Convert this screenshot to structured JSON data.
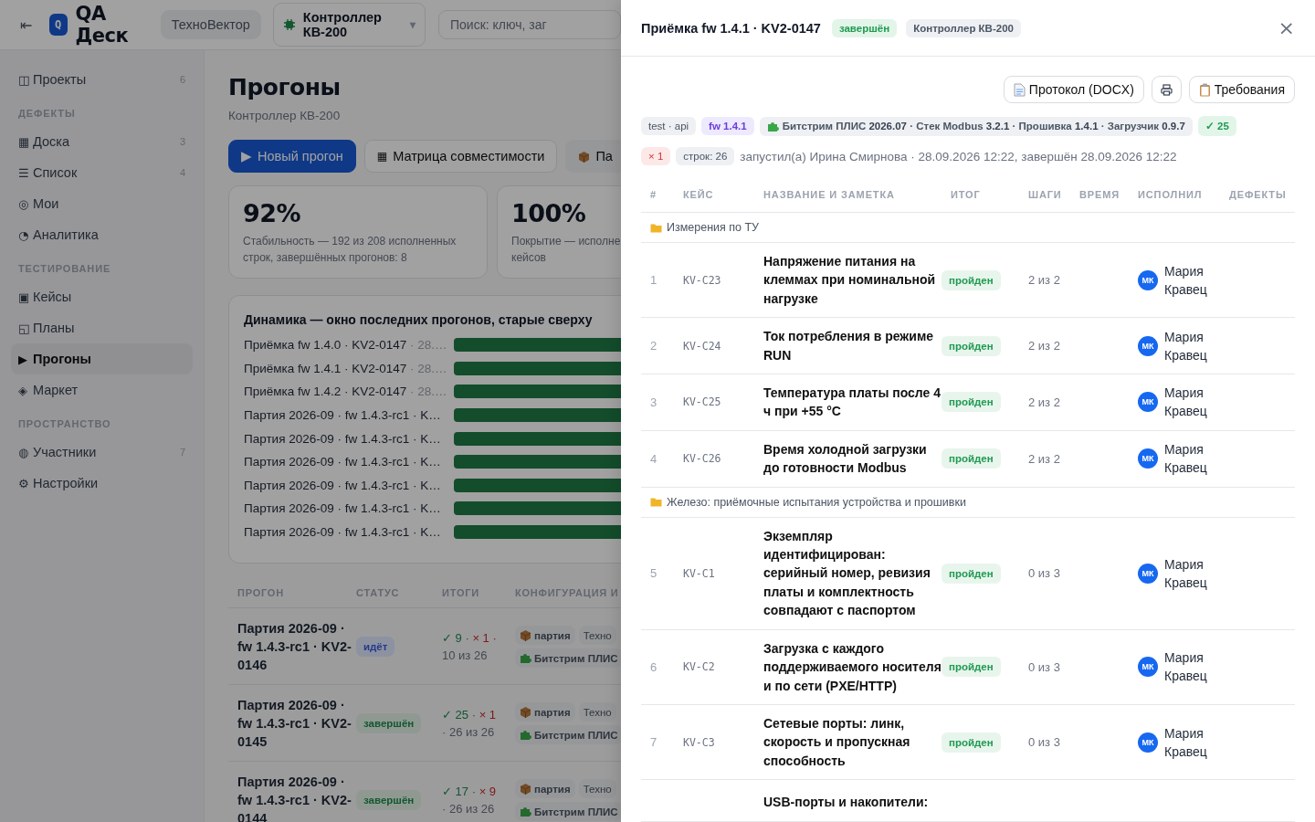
{
  "topbar": {
    "back_icon": "⇤",
    "logo_letter": "Q",
    "app_name": "QA Деск",
    "workspace": "ТехноВектор",
    "project": "Контроллер КВ-200",
    "project_caret": "▾",
    "search": {
      "placeholder": "Поиск: ключ, заг"
    }
  },
  "sidebar": {
    "items": [
      {
        "kind": "item",
        "icon": "◫",
        "label": "Проекты",
        "count": "6",
        "selected": false
      },
      {
        "kind": "section",
        "label": "ДЕФЕКТЫ"
      },
      {
        "kind": "item",
        "icon": "▦",
        "label": "Доска",
        "count": "3",
        "selected": false
      },
      {
        "kind": "item",
        "icon": "☰",
        "label": "Список",
        "count": "4",
        "selected": false
      },
      {
        "kind": "item",
        "icon": "◎",
        "label": "Мои",
        "selected": false
      },
      {
        "kind": "item",
        "icon": "◔",
        "label": "Аналитика",
        "selected": false
      },
      {
        "kind": "section",
        "label": "ТЕСТИРОВАНИЕ"
      },
      {
        "kind": "item",
        "icon": "▣",
        "label": "Кейсы",
        "selected": false
      },
      {
        "kind": "item",
        "icon": "◱",
        "label": "Планы",
        "selected": false
      },
      {
        "kind": "item",
        "icon": "▶",
        "label": "Прогоны",
        "selected": true
      },
      {
        "kind": "item",
        "icon": "◈",
        "label": "Маркет",
        "selected": false
      },
      {
        "kind": "section",
        "label": "ПРОСТРАНСТВО"
      },
      {
        "kind": "item",
        "icon": "◍",
        "label": "Участники",
        "count": "7",
        "selected": false
      },
      {
        "kind": "item",
        "icon": "⚙",
        "label": "Настройки",
        "selected": false
      }
    ]
  },
  "page": {
    "title": "Прогоны",
    "subtitle": "Контроллер КВ-200",
    "actions": [
      {
        "kind": "primary",
        "icon": "▶",
        "label": "Новый прогон"
      },
      {
        "kind": "secondary",
        "icon": "▦",
        "label": "Матрица совместимости"
      },
      {
        "kind": "package",
        "label": "Па"
      }
    ],
    "stats": [
      {
        "value": "92%",
        "caption_lines": [
          "Стабильность — 192 из 208 исполненных",
          "строк, завершённых прогонов: 8"
        ]
      },
      {
        "value": "100%",
        "caption_lines": [
          "Покрытие — исполне",
          "кейсов"
        ]
      }
    ],
    "trend": {
      "title": "Динамика — окно последних прогонов, старые сверху",
      "rows": [
        {
          "label": "Приёмка fw 1.4.0 · KV2-0147",
          "meta": "· 28.…"
        },
        {
          "label": "Приёмка fw 1.4.1 · KV2-0147",
          "meta": "· 28.…"
        },
        {
          "label": "Приёмка fw 1.4.2 · KV2-0147",
          "meta": "· 28.…"
        },
        {
          "label": "Партия 2026-09 · fw 1.4.3-rc1 · K…"
        },
        {
          "label": "Партия 2026-09 · fw 1.4.3-rc1 · K…"
        },
        {
          "label": "Партия 2026-09 · fw 1.4.3-rc1 · K…"
        },
        {
          "label": "Партия 2026-09 · fw 1.4.3-rc1 · K…"
        },
        {
          "label": "Партия 2026-09 · fw 1.4.3-rc1 · K…"
        },
        {
          "label": "Партия 2026-09 · fw 1.4.3-rc1 · K…"
        }
      ]
    },
    "runs": {
      "columns": [
        "ПРОГОН",
        "СТАТУС",
        "ИТОГИ",
        "КОНФИГУРАЦИЯ И"
      ],
      "rows": [
        {
          "name": "Партия 2026-09 · fw 1.4.3-rc1 · KV2-0146",
          "status": {
            "kind": "running",
            "text": "идёт"
          },
          "passed": "✓ 9 ·",
          "failed": "× 1 ·",
          "total": "10 из 26",
          "tags": [
            {
              "kind": "box",
              "text": "партия"
            },
            {
              "kind": "plain",
              "text": "Техно"
            },
            {
              "kind": "puzzle",
              "text": "Битстрим ПЛИС"
            }
          ]
        },
        {
          "name": "Партия 2026-09 · fw 1.4.3-rc1 · KV2-0145",
          "status": {
            "kind": "done",
            "text": "завершён"
          },
          "passed": "✓ 25 ·",
          "failed": "× 1",
          "total": "· 26 из 26",
          "tags": [
            {
              "kind": "box",
              "text": "партия"
            },
            {
              "kind": "plain",
              "text": "Техно"
            },
            {
              "kind": "puzzle",
              "text": "Битстрим ПЛИС"
            }
          ]
        },
        {
          "name": "Партия 2026-09 · fw 1.4.3-rc1 · KV2-0144",
          "status": {
            "kind": "done",
            "text": "завершён"
          },
          "passed": "✓ 17 ·",
          "failed": "× 9",
          "total": "· 26 из 26",
          "tags": [
            {
              "kind": "box",
              "text": "партия"
            },
            {
              "kind": "plain",
              "text": "Техно"
            },
            {
              "kind": "puzzle",
              "text": "Битстрим ПЛИС"
            }
          ]
        }
      ]
    }
  },
  "drawer": {
    "title": "Приёмка fw 1.4.1 · KV2-0147",
    "status": {
      "kind": "done",
      "text": "завершён"
    },
    "project": "Контроллер КВ-200",
    "close": "×",
    "actions": [
      {
        "kind": "docx",
        "label": "Протокол (DOCX)"
      },
      {
        "kind": "print"
      },
      {
        "kind": "requirements",
        "label": "Требования"
      }
    ],
    "tags": [
      {
        "kind": "plain",
        "text": "test · api"
      },
      {
        "kind": "version",
        "text": "fw 1.4.1"
      },
      {
        "kind": "config",
        "text": "Битстрим ПЛИС **2026.07** · Стек Modbus **3.2.1** · Прошивка **1.4.1** · Загрузчик **0.9.7**"
      },
      {
        "kind": "passed",
        "text": "✓ 25"
      },
      {
        "kind": "failed",
        "text": "× 1"
      },
      {
        "kind": "plain",
        "text": "строк: 26"
      }
    ],
    "started": "запустил(а) Ирина Смирнова · 28.09.2026 12:22, завершён 28.09.2026 12:22",
    "table": {
      "columns": [
        "#",
        "КЕЙС",
        "НАЗВАНИЕ И ЗАМЕТКА",
        "ИТОГ",
        "ШАГИ",
        "ВРЕМЯ",
        "ИСПОЛНИЛ",
        "ДЕФЕКТЫ"
      ],
      "rows": [
        {
          "kind": "group",
          "title": "Измерения по ТУ"
        },
        {
          "kind": "case",
          "num": "1",
          "key": "KV-C23",
          "name": "Напряжение питания на клеммах при номинальной нагрузке",
          "result": {
            "kind": "passed",
            "text": "пройден"
          },
          "steps": "2 из 2",
          "executor": {
            "initials": "МК",
            "name": "Мария Кравец"
          }
        },
        {
          "kind": "case",
          "num": "2",
          "key": "KV-C24",
          "name": "Ток потребления в режиме RUN",
          "result": {
            "kind": "passed",
            "text": "пройден"
          },
          "steps": "2 из 2",
          "executor": {
            "initials": "МК",
            "name": "Мария Кравец"
          }
        },
        {
          "kind": "case",
          "num": "3",
          "key": "KV-C25",
          "name": "Температура платы после 4 ч при +55 °C",
          "result": {
            "kind": "passed",
            "text": "пройден"
          },
          "steps": "2 из 2",
          "executor": {
            "initials": "МК",
            "name": "Мария Кравец"
          }
        },
        {
          "kind": "case",
          "num": "4",
          "key": "KV-C26",
          "name": "Время холодной загрузки до готовности Modbus",
          "result": {
            "kind": "passed",
            "text": "пройден"
          },
          "steps": "2 из 2",
          "executor": {
            "initials": "МК",
            "name": "Мария Кравец"
          }
        },
        {
          "kind": "group",
          "title": "Железо: приёмочные испытания устройства и прошивки"
        },
        {
          "kind": "case",
          "num": "5",
          "key": "KV-C1",
          "name": "Экземпляр идентифицирован: серийный номер, ревизия платы и комплектность совпадают с паспортом",
          "result": {
            "kind": "passed",
            "text": "пройден"
          },
          "steps": "0 из 3",
          "executor": {
            "initials": "МК",
            "name": "Мария Кравец"
          }
        },
        {
          "kind": "case",
          "num": "6",
          "key": "KV-C2",
          "name": "Загрузка с каждого поддерживаемого носителя и по сети (PXE/HTTP)",
          "result": {
            "kind": "passed",
            "text": "пройден"
          },
          "steps": "0 из 3",
          "executor": {
            "initials": "МК",
            "name": "Мария Кравец"
          }
        },
        {
          "kind": "case",
          "num": "7",
          "key": "KV-C3",
          "name": "Сетевые порты: линк, скорость и пропускная способность",
          "result": {
            "kind": "passed",
            "text": "пройден"
          },
          "steps": "0 из 3",
          "executor": {
            "initials": "МК",
            "name": "Мария Кравец"
          }
        },
        {
          "kind": "cut",
          "name": "USB-порты и накопители:"
        }
      ]
    }
  }
}
